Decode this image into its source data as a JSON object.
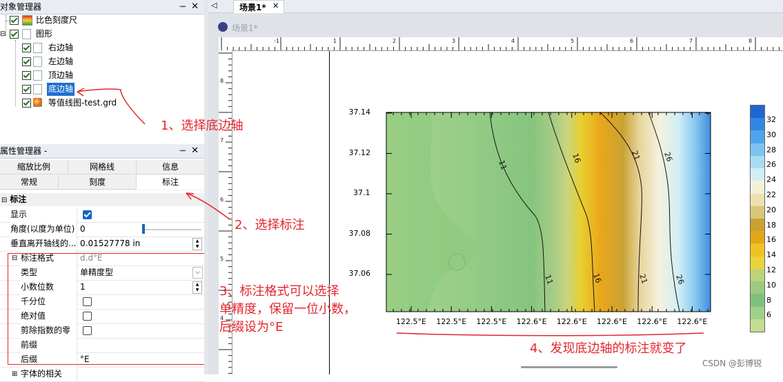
{
  "object_manager": {
    "title": "对象管理器",
    "items": [
      {
        "label": "比色刻度尺"
      },
      {
        "label": "图形"
      },
      {
        "label": "右边轴"
      },
      {
        "label": "左边轴"
      },
      {
        "label": "顶边轴"
      },
      {
        "label": "底边轴"
      },
      {
        "label": "等值线图-test.grd"
      }
    ]
  },
  "property_manager": {
    "title": "属性管理器 -",
    "tabs_row1": [
      "缩放比例",
      "网格线",
      "信息"
    ],
    "tabs_row2": [
      "常规",
      "刻度",
      "标注"
    ],
    "section": "标注",
    "rows": {
      "display": "显示",
      "angle": "角度(以度为单位)",
      "angle_value": "0",
      "offset": "垂直离开轴线的...",
      "offset_value": "0.01527778 in",
      "label_format": "标注格式",
      "label_format_value": "d.d°E",
      "type": "类型",
      "type_value": "单精度型",
      "decimals": "小数位数",
      "decimals_value": "1",
      "thousands": "千分位",
      "absolute": "绝对值",
      "trim_zeros": "剪除指数的零",
      "prefix": "前缀",
      "suffix": "后缀",
      "suffix_value": "°E",
      "font": "字体的相关"
    }
  },
  "document_tab": {
    "label": "场景1*",
    "view_title": "场景1*"
  },
  "plot": {
    "y_ticks": [
      "37.14",
      "37.12",
      "37.1",
      "37.08",
      "37.06"
    ],
    "x_ticks": [
      "122.5°E",
      "122.5°E",
      "122.5°E",
      "122.6°E",
      "122.6°E",
      "122.6°E",
      "122.6°E",
      "122.6°E"
    ],
    "contour_labels": [
      "11",
      "16",
      "21",
      "26",
      "11",
      "16",
      "21",
      "26"
    ],
    "colorbar_labels": [
      "32",
      "30",
      "28",
      "26",
      "24",
      "22",
      "20",
      "18",
      "16",
      "14",
      "12",
      "10",
      "8",
      "6"
    ],
    "colorbar_colors": [
      "#1f66d1",
      "#2f88e4",
      "#4ea5ec",
      "#7cc3f0",
      "#a9dcf2",
      "#d3eef5",
      "#f4f1d8",
      "#efe0b0",
      "#dac57a",
      "#c8a230",
      "#e3a51c",
      "#efc323",
      "#e9d43a",
      "#bed27a",
      "#9ccb7e",
      "#7fc07e",
      "#9fd08a",
      "#c3dd91"
    ],
    "ruler_top": [
      "-1",
      "1",
      "2",
      "3",
      "4",
      "5",
      "6",
      "7",
      "8"
    ],
    "ruler_left": [
      "8",
      "7",
      "6",
      "5",
      "4",
      "3"
    ]
  },
  "annotations": {
    "a1": "1、选择底边轴",
    "a2": "2、选择标注",
    "a3_line1": "3、标注格式可以选择",
    "a3_line2": "单精度，保留一位小数，",
    "a3_line3": "后缀设为°E",
    "a4": "4、发现底边轴的标注就变了"
  },
  "watermark": "CSDN @彭博锐"
}
